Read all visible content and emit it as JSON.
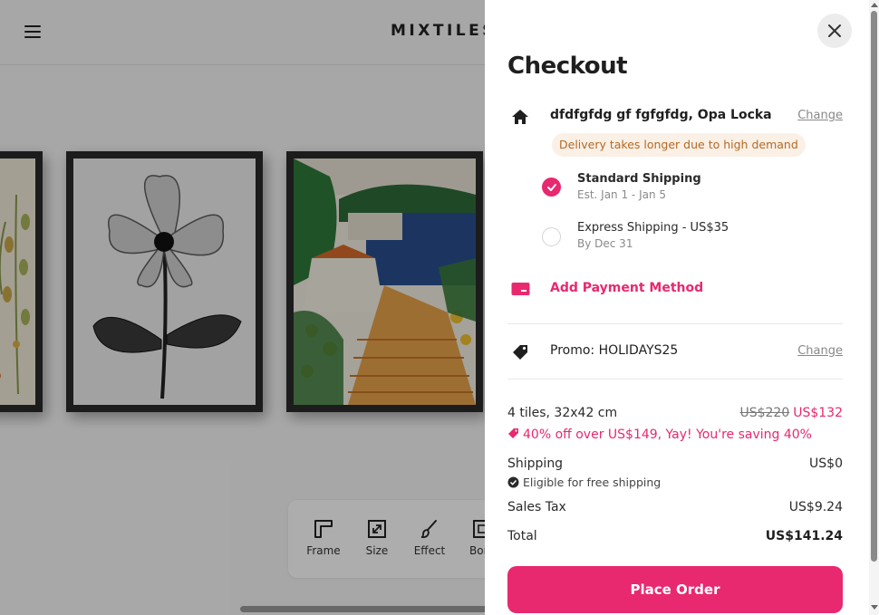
{
  "app": {
    "brand": "MIXTILES"
  },
  "toolbar": {
    "items": [
      {
        "label": "Frame",
        "icon": "frame-icon"
      },
      {
        "label": "Size",
        "icon": "resize-icon"
      },
      {
        "label": "Effect",
        "icon": "brush-icon"
      },
      {
        "label": "Bord",
        "icon": "border-icon"
      }
    ]
  },
  "checkout": {
    "title": "Checkout",
    "address": {
      "text": "dfdfgfdg gf fgfgfdg, Opa Locka",
      "change_label": "Change",
      "notice": "Delivery takes longer due to high demand"
    },
    "shipping_options": [
      {
        "name": "Standard Shipping",
        "sub": "Est. Jan 1 - Jan 5",
        "selected": true
      },
      {
        "name": "Express Shipping - US$35",
        "sub": "By Dec 31",
        "selected": false
      }
    ],
    "payment": {
      "label": "Add Payment Method"
    },
    "promo": {
      "text": "Promo: HOLIDAYS25",
      "change_label": "Change"
    },
    "summary": {
      "items_label": "4 tiles, 32x42 cm",
      "old_price": "US$220",
      "new_price": "US$132",
      "discount_text": "40% off over US$149, Yay! You're saving 40%",
      "shipping_label": "Shipping",
      "shipping_value": "US$0",
      "free_shipping_text": "Eligible for free shipping",
      "tax_label": "Sales Tax",
      "tax_value": "US$9.24",
      "total_label": "Total",
      "total_value": "US$141.24"
    },
    "place_order_label": "Place Order"
  },
  "colors": {
    "accent": "#e8286f",
    "notice_bg": "#fbf0e6",
    "notice_text": "#b36a26"
  }
}
